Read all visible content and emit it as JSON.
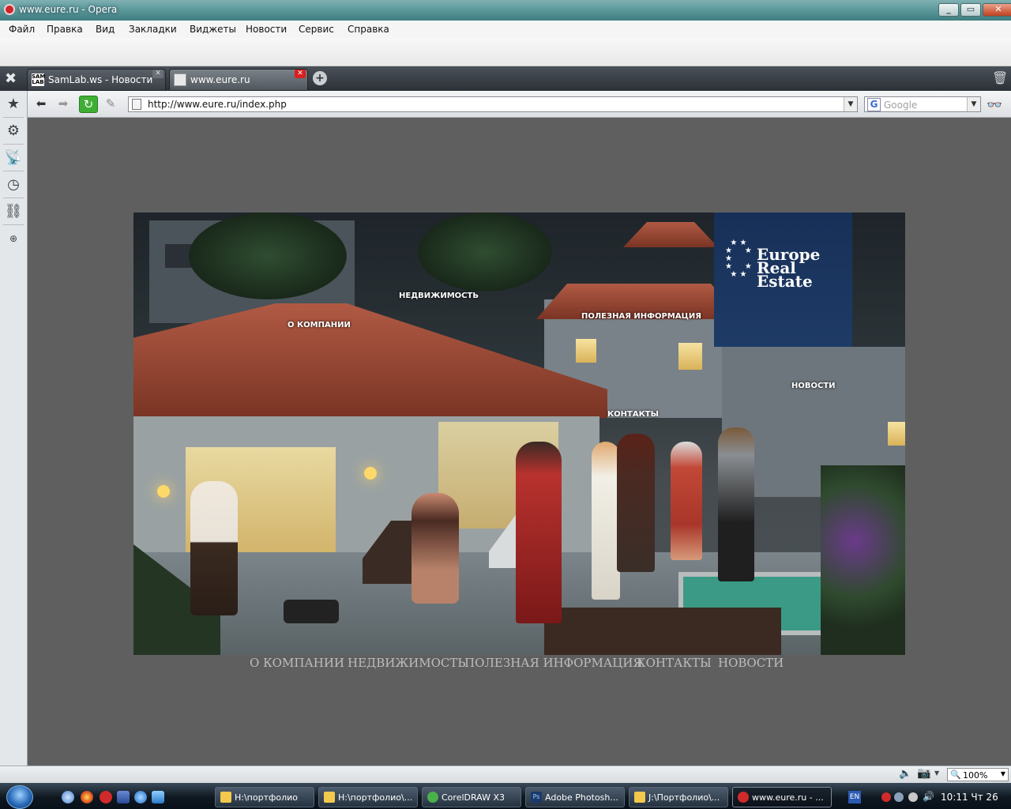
{
  "window": {
    "title": "www.eure.ru - Opera"
  },
  "menu": [
    "Файл",
    "Правка",
    "Вид",
    "Закладки",
    "Виджеты",
    "Новости",
    "Сервис",
    "Справка"
  ],
  "tabs": [
    {
      "label": "SamLab.ws - Новости",
      "favicon_text": "SAM LAB"
    },
    {
      "label": "www.eure.ru"
    }
  ],
  "address": {
    "url": "http://www.eure.ru/index.php"
  },
  "search": {
    "placeholder": "Google"
  },
  "site": {
    "logo_lines": [
      "Europe",
      "Real",
      "Estate"
    ],
    "hero_links": [
      "НЕДВИЖИМОСТЬ",
      "О КОМПАНИИ",
      "ПОЛЕЗНАЯ ИНФОРМАЦИЯ",
      "НОВОСТИ",
      "КОНТАКТЫ"
    ],
    "footer_links": [
      "О КОМПАНИИ",
      "НЕДВИЖИМОСТЬ",
      "ПОЛЕЗНАЯ ИНФОРМАЦИЯ",
      "КОНТАКТЫ",
      "НОВОСТИ"
    ]
  },
  "status": {
    "zoom": "100%"
  },
  "taskbar": {
    "windows": [
      "H:\\портфолио",
      "H:\\портфолио\\...",
      "CorelDRAW X3",
      "Adobe Photosh...",
      "J:\\Портфолио\\...",
      "www.eure.ru - ..."
    ],
    "lang": "EN",
    "clock": "10:11 Чт 26"
  },
  "colors": {
    "accent_blue": "#1e3b66",
    "page_bg": "#5f5f5f",
    "active_tab_close": "#d72020"
  }
}
